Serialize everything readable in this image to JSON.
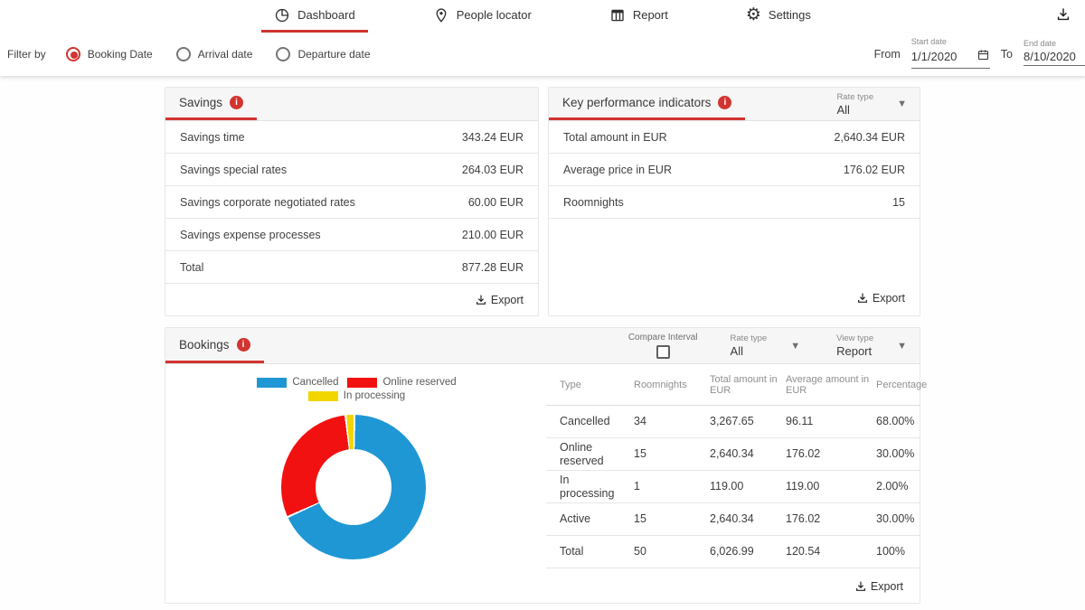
{
  "nav": {
    "tabs": [
      {
        "label": "Dashboard",
        "active": true
      },
      {
        "label": "People locator",
        "active": false
      },
      {
        "label": "Report",
        "active": false
      },
      {
        "label": "Settings",
        "active": false
      }
    ]
  },
  "filter": {
    "label": "Filter by",
    "options": [
      {
        "label": "Booking Date",
        "selected": true
      },
      {
        "label": "Arrival date",
        "selected": false
      },
      {
        "label": "Departure date",
        "selected": false
      }
    ],
    "from_label": "From",
    "to_label": "To",
    "start_date": {
      "label": "Start date",
      "value": "1/1/2020"
    },
    "end_date": {
      "label": "End date",
      "value": "8/10/2020"
    }
  },
  "savings": {
    "title": "Savings",
    "rows": [
      {
        "label": "Savings time",
        "value": "343.24 EUR"
      },
      {
        "label": "Savings special rates",
        "value": "264.03 EUR"
      },
      {
        "label": "Savings corporate negotiated rates",
        "value": "60.00 EUR"
      },
      {
        "label": "Savings expense processes",
        "value": "210.00 EUR"
      },
      {
        "label": "Total",
        "value": "877.28 EUR"
      }
    ],
    "export_label": "Export"
  },
  "kpi": {
    "title": "Key performance indicators",
    "rate_type": {
      "label": "Rate type",
      "value": "All"
    },
    "rows": [
      {
        "label": "Total amount in EUR",
        "value": "2,640.34 EUR"
      },
      {
        "label": "Average price in EUR",
        "value": "176.02 EUR"
      },
      {
        "label": "Roomnights",
        "value": "15"
      }
    ],
    "export_label": "Export"
  },
  "bookings": {
    "title": "Bookings",
    "compare_interval_label": "Compare Interval",
    "rate_type": {
      "label": "Rate type",
      "value": "All"
    },
    "view_type": {
      "label": "View type",
      "value": "Report"
    },
    "chart_data": {
      "type": "pie",
      "segments": [
        {
          "label": "Cancelled",
          "value": 68,
          "color": "#1f97d4"
        },
        {
          "label": "Online reserved",
          "value": 30,
          "color": "#f21111"
        },
        {
          "label": "In processing",
          "value": 2,
          "color": "#f2d600"
        }
      ]
    },
    "table": {
      "headers": [
        "Type",
        "Roomnights",
        "Total amount in EUR",
        "Average amount in EUR",
        "Percentage"
      ],
      "rows": [
        [
          "Cancelled",
          "34",
          "3,267.65",
          "96.11",
          "68.00%"
        ],
        [
          "Online reserved",
          "15",
          "2,640.34",
          "176.02",
          "30.00%"
        ],
        [
          "In processing",
          "1",
          "119.00",
          "119.00",
          "2.00%"
        ],
        [
          "Active",
          "15",
          "2,640.34",
          "176.02",
          "30.00%"
        ],
        [
          "Total",
          "50",
          "6,026.99",
          "120.54",
          "100%"
        ]
      ]
    },
    "export_label": "Export"
  },
  "colors": {
    "accent": "#d23430",
    "blue": "#1f97d4",
    "red": "#f21111",
    "yellow": "#f2d600"
  }
}
